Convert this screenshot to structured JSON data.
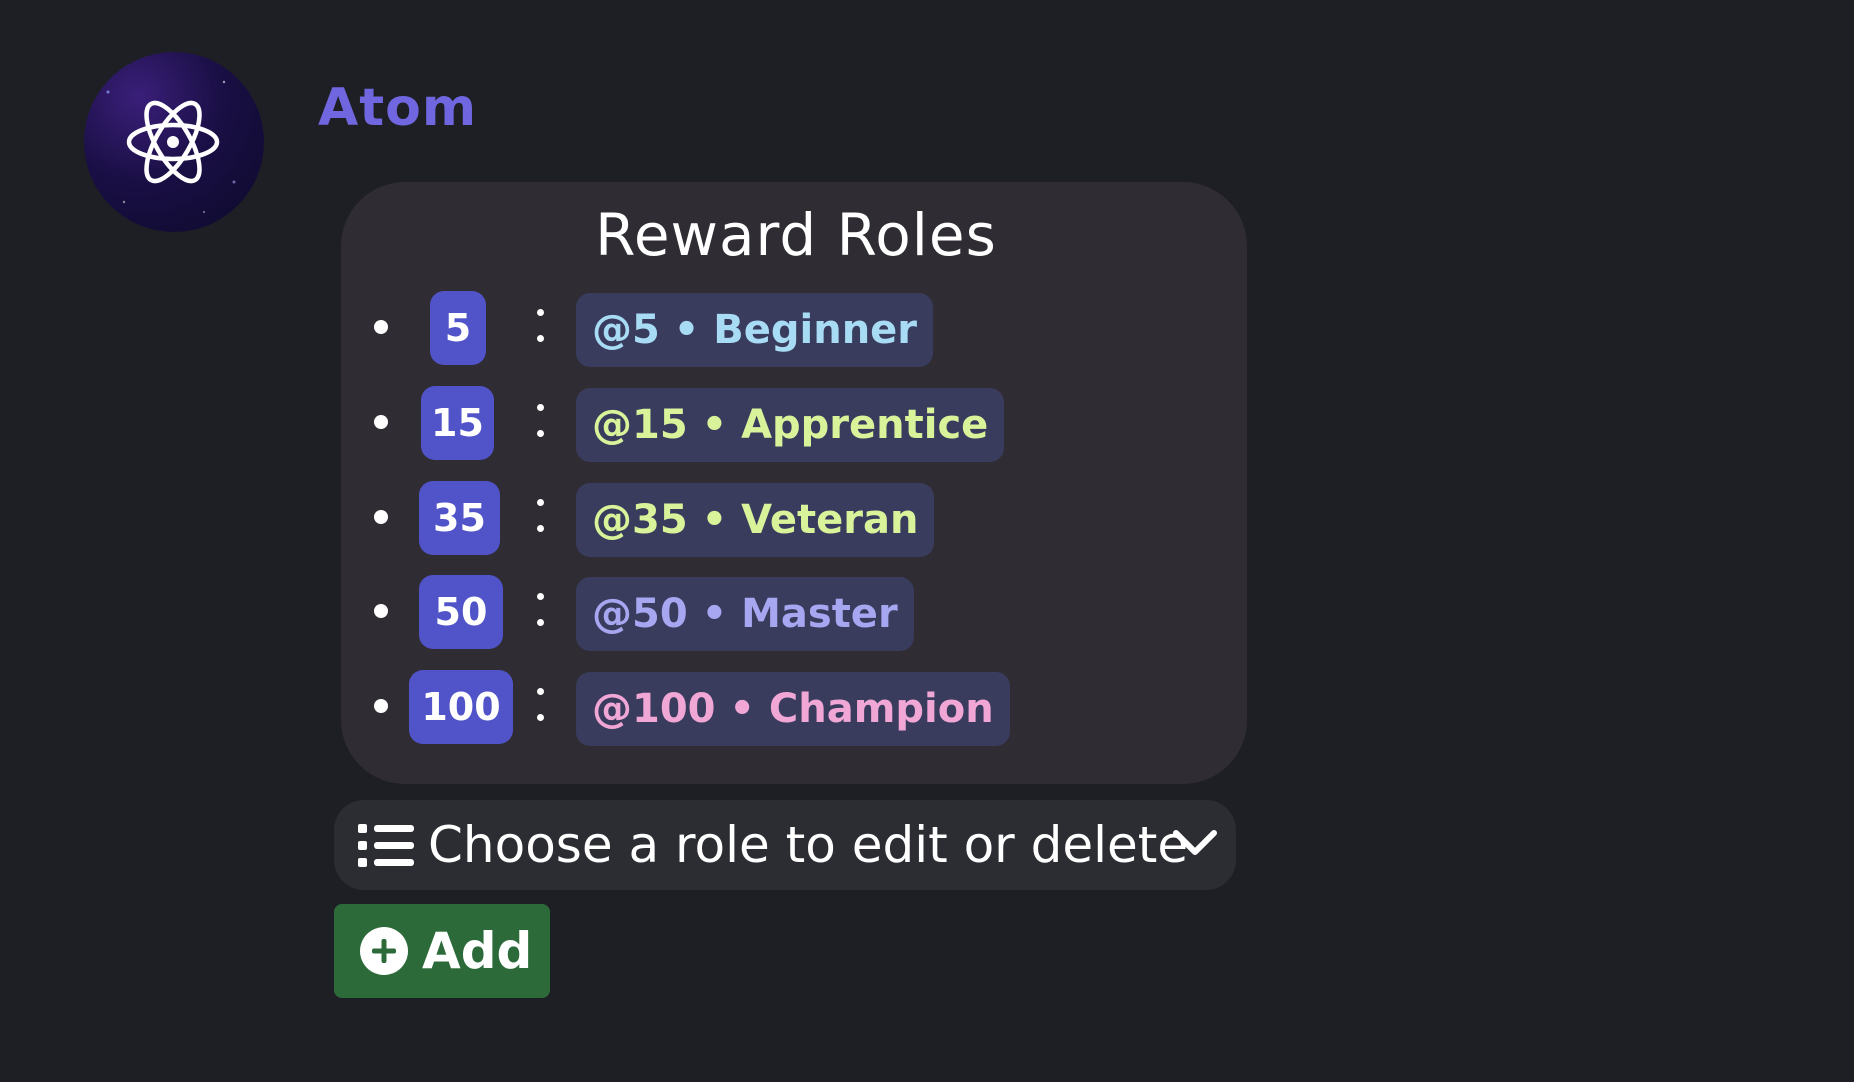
{
  "message": {
    "author": "Atom",
    "avatar_icon": "atom-icon"
  },
  "embed": {
    "title": "Reward Roles",
    "rewards": [
      {
        "level": "5",
        "role": "@5 • Beginner",
        "color": "#a8dcf5"
      },
      {
        "level": "15",
        "role": "@15 • Apprentice",
        "color": "#d9f39a"
      },
      {
        "level": "35",
        "role": "@35 • Veteran",
        "color": "#d9f39a"
      },
      {
        "level": "50",
        "role": "@50 • Master",
        "color": "#a7a6f0"
      },
      {
        "level": "100",
        "role": "@100 • Champion",
        "color": "#f1a7d6"
      }
    ]
  },
  "select_menu": {
    "placeholder": "Choose a role to edit or delete",
    "icon": "list-icon",
    "dropdown_icon": "chevron-down-icon"
  },
  "add_button": {
    "label": "Add",
    "icon": "plus-circle-icon",
    "color": "#2d6a3a"
  },
  "colors": {
    "background": "#1e1f24",
    "author": "#7067e0",
    "level_badge": "#5154c9",
    "role_pill": "#3a3c5e",
    "card": "#2f2c33"
  }
}
